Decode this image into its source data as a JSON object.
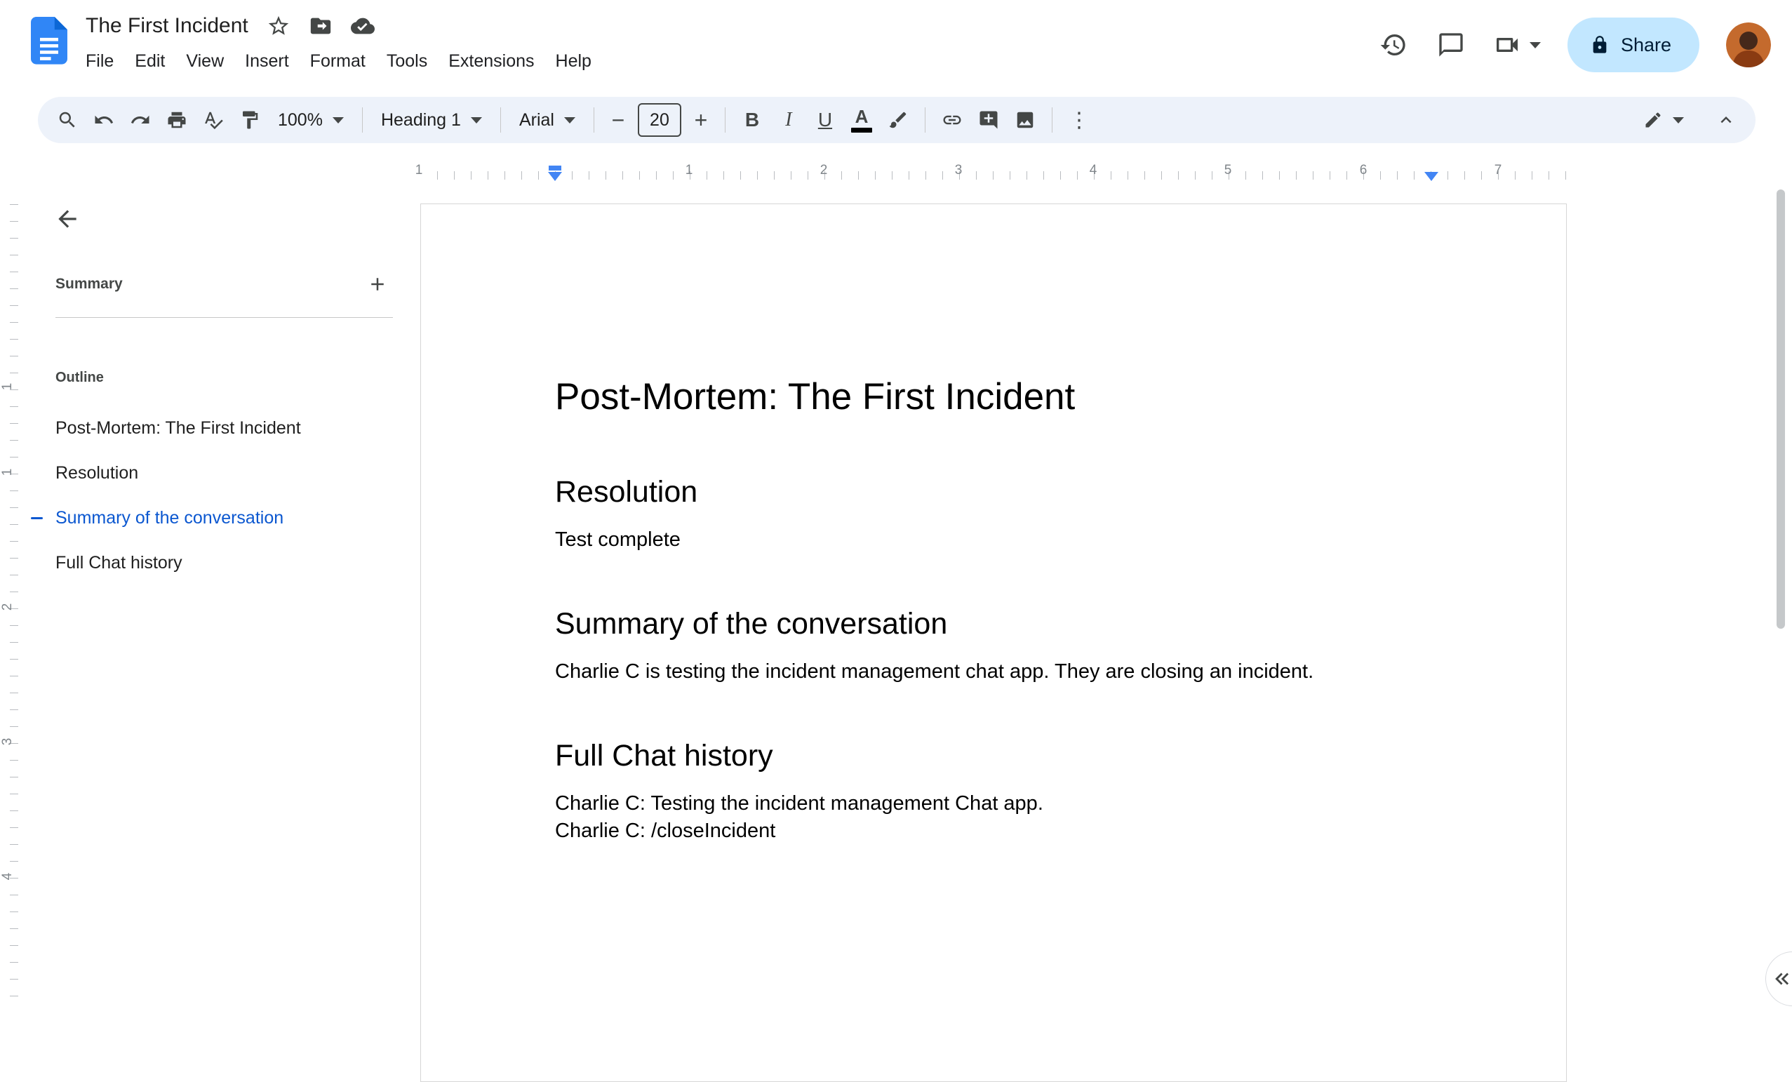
{
  "header": {
    "doc_title": "The First Incident",
    "menus": [
      "File",
      "Edit",
      "View",
      "Insert",
      "Format",
      "Tools",
      "Extensions",
      "Help"
    ],
    "share_label": "Share"
  },
  "toolbar": {
    "zoom_value": "100%",
    "style_value": "Heading 1",
    "font_value": "Arial",
    "font_size_value": "20",
    "bold_glyph": "B",
    "italic_glyph": "I",
    "underline_glyph": "U",
    "text_color_glyph": "A",
    "minus_glyph": "−",
    "plus_glyph": "+",
    "more_glyph": "⋮"
  },
  "ruler": {
    "h_labels": [
      "1",
      "1",
      "2",
      "3",
      "4",
      "5",
      "6",
      "7"
    ],
    "v_labels": [
      "1",
      "1",
      "2",
      "3",
      "4"
    ]
  },
  "sidebar": {
    "summary_label": "Summary",
    "outline_label": "Outline",
    "items": [
      {
        "label": "Post-Mortem: The First Incident",
        "active": false
      },
      {
        "label": "Resolution",
        "active": false
      },
      {
        "label": "Summary of the conversation",
        "active": true
      },
      {
        "label": "Full Chat history",
        "active": false
      }
    ]
  },
  "document": {
    "title": "Post-Mortem: The First Incident",
    "sections": [
      {
        "heading": "Resolution",
        "paragraphs": [
          "Test complete"
        ]
      },
      {
        "heading": "Summary of the conversation",
        "paragraphs": [
          "Charlie C is testing the incident management chat app. They are closing an incident."
        ]
      },
      {
        "heading": "Full Chat history",
        "paragraphs": [
          "Charlie C: Testing the incident management Chat app.",
          "Charlie C: /closeIncident"
        ]
      }
    ]
  },
  "colors": {
    "accent_blue": "#0b57d0",
    "share_bg": "#c2e7ff",
    "toolbar_bg": "#edf2fa",
    "icon_gray": "#444746",
    "ruler_marker_blue": "#4285f4"
  },
  "icons": [
    "docs-logo",
    "star",
    "move-folder",
    "cloud-status",
    "version-history",
    "comments",
    "meet-video",
    "lock",
    "avatar",
    "search",
    "undo",
    "redo",
    "print",
    "spellcheck",
    "paint-format",
    "bold",
    "italic",
    "underline",
    "text-color",
    "highlight",
    "link",
    "add-comment",
    "insert-image",
    "more-vertical",
    "edit-mode-pencil",
    "collapse-toolbar",
    "back-arrow",
    "add-summary",
    "double-chevron-left"
  ]
}
